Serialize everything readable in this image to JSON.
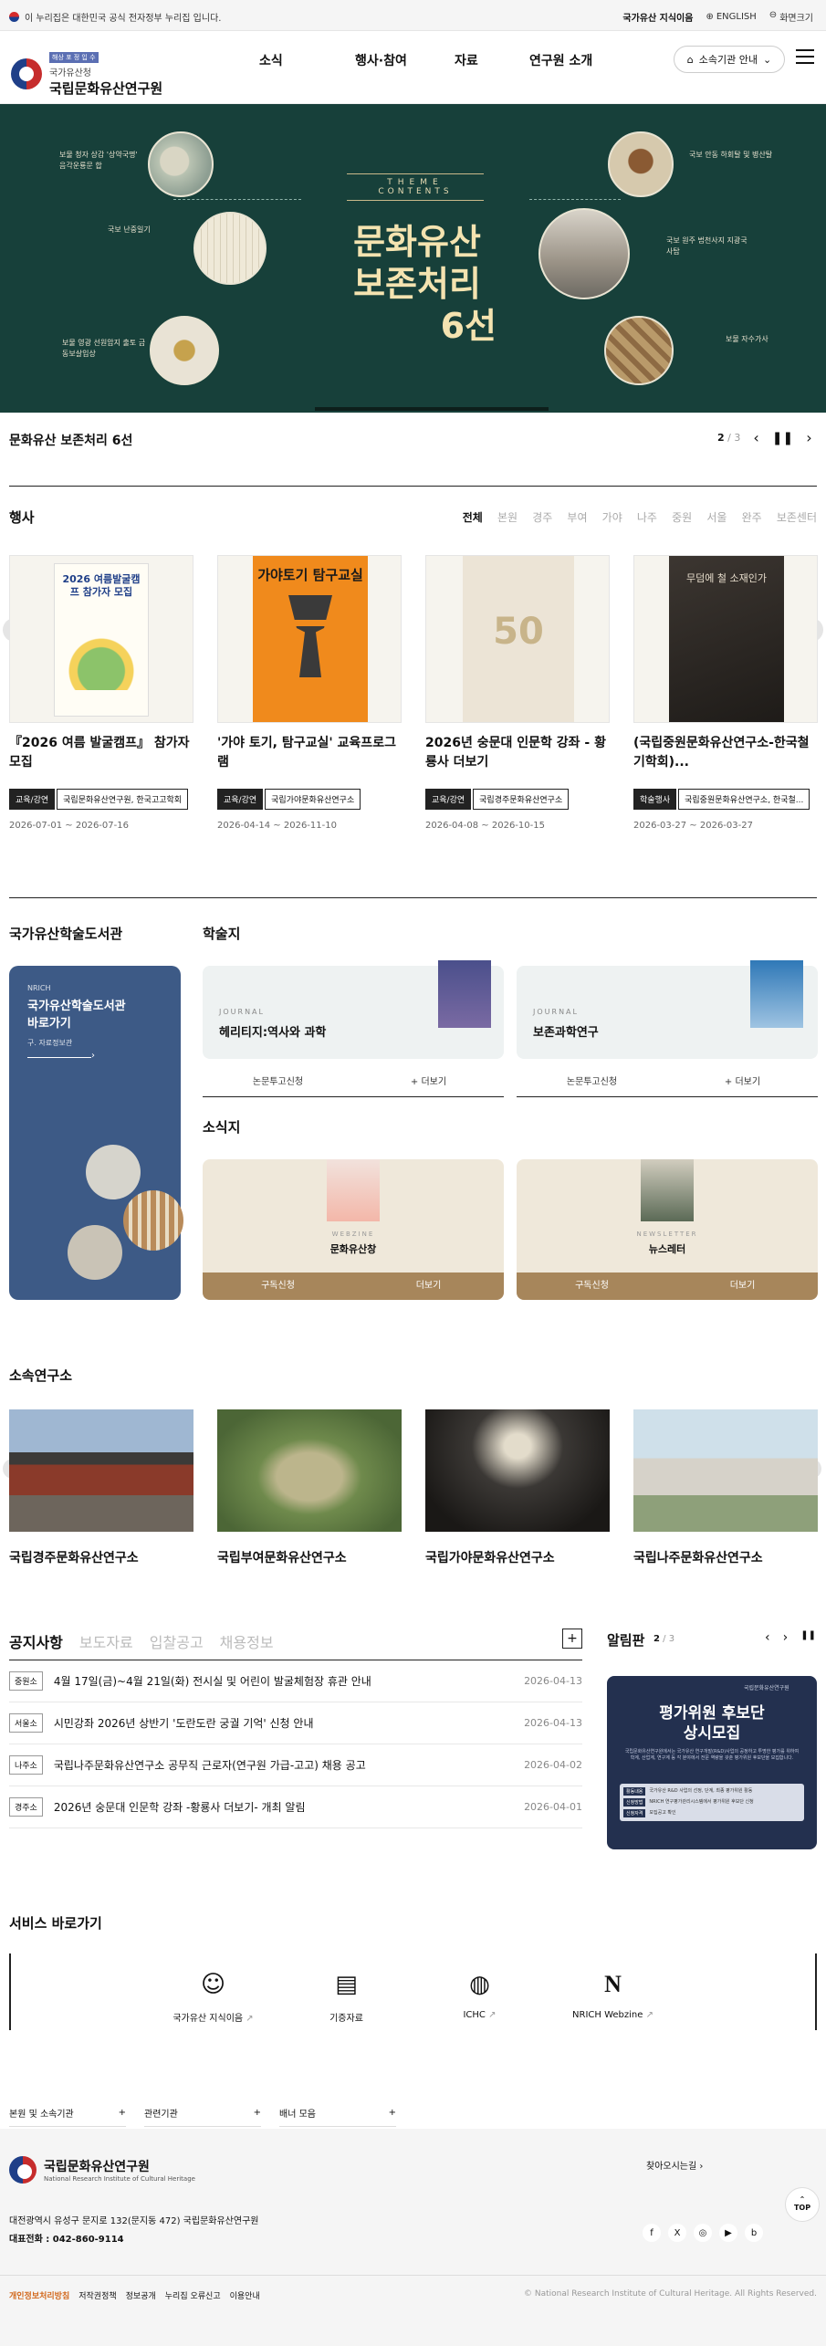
{
  "govbar": {
    "notice": "이 누리집은 대한민국 공식 전자정부 누리집 입니다.",
    "links": [
      "국가유산 지식이음",
      "ENGLISH",
      "화면크기"
    ]
  },
  "header": {
    "badge": "해상 포 정 입 수",
    "org_top": "국가유산청",
    "org_name": "국립문화유산연구원",
    "nav": [
      "소식",
      "행사·참여",
      "자료",
      "연구원 소개"
    ],
    "institute_btn": "소속기관 안내"
  },
  "hero": {
    "theme": "THEME",
    "contents": "CONTENTS",
    "title_line1": "문화유산",
    "title_line2": "보존처리",
    "title_num": "6선",
    "captions": [
      "보물 청자 상감 '상약국명' 음각운룡문 합",
      "국보 난중일기",
      "보물 영광 선원암지 출토 금동보살입상",
      "국보 안동 하회탈 및 병산탈",
      "국보 원주 법천사지 지광국사탑",
      "보물 자수가사"
    ]
  },
  "slide": {
    "caption": "문화유산 보존처리 6선",
    "current": "2",
    "total": "3"
  },
  "events": {
    "title": "행사",
    "tabs": [
      "전체",
      "본원",
      "경주",
      "부여",
      "가야",
      "나주",
      "중원",
      "서울",
      "완주",
      "보존센터"
    ],
    "items": [
      {
        "title": "『2026 여름 발굴캠프』 참가자 모집",
        "tags": [
          "교육/강연",
          "국립문화유산연구원, 한국고고학회"
        ],
        "date": "2026-07-01 ~ 2026-07-16",
        "poster_text": "2026 여름발굴캠프 참가자 모집"
      },
      {
        "title": "'가야 토기, 탐구교실' 교육프로그램",
        "tags": [
          "교육/강연",
          "국립가야문화유산연구소"
        ],
        "date": "2026-04-14 ~ 2026-11-10",
        "poster_text": "가야토기 탐구교실"
      },
      {
        "title": "2026년 숭문대 인문학 강좌 - 황룡사 더보기",
        "tags": [
          "교육/강연",
          "국립경주문화유산연구소"
        ],
        "date": "2026-04-08 ~ 2026-10-15",
        "poster_text": "50"
      },
      {
        "title": "(국립중원문화유산연구소-한국철기학회)...",
        "tags": [
          "학술행사",
          "국립중원문화유산연구소, 한국철..."
        ],
        "date": "2026-03-27 ~ 2026-03-27",
        "poster_text": "무덤에 철 소재인가"
      }
    ]
  },
  "library": {
    "title": "국가유산학술도서관",
    "card_small": "NRICH",
    "card_title1": "국가유산학술도서관",
    "card_title2": "바로가기",
    "card_sub": "구. 자료정보관",
    "journals_title": "학술지",
    "journals": [
      {
        "label": "JOURNAL",
        "name": "헤리티지:역사와 과학",
        "btn1": "논문투고신청",
        "btn2": "+ 더보기"
      },
      {
        "label": "JOURNAL",
        "name": "보존과학연구",
        "btn1": "논문투고신청",
        "btn2": "+ 더보기"
      }
    ],
    "news_title": "소식지",
    "mags": [
      {
        "label": "WEBZINE",
        "name": "문화유산창",
        "btn1": "구독신청",
        "btn2": "더보기"
      },
      {
        "label": "NEWSLETTER",
        "name": "뉴스레터",
        "btn1": "구독신청",
        "btn2": "더보기"
      }
    ]
  },
  "institutes": {
    "title": "소속연구소",
    "items": [
      "국립경주문화유산연구소",
      "국립부여문화유산연구소",
      "국립가야문화유산연구소",
      "국립나주문화유산연구소"
    ]
  },
  "notices": {
    "tabs": [
      "공지사항",
      "보도자료",
      "입찰공고",
      "채용정보"
    ],
    "rows": [
      {
        "badge": "중원소",
        "text": "4월 17일(금)~4월 21일(화) 전시실 및 어린이 발굴체험장 휴관 안내",
        "date": "2026-04-13"
      },
      {
        "badge": "서울소",
        "text": "시민강좌 2026년 상반기 '도란도란 궁궐 기억' 신청 안내",
        "date": "2026-04-13"
      },
      {
        "badge": "나주소",
        "text": "국립나주문화유산연구소 공무직 근로자(연구원 가급-고고) 채용 공고",
        "date": "2026-04-02"
      },
      {
        "badge": "경주소",
        "text": "2026년 숭문대 인문학 강좌 -황룡사 더보기- 개최 알림",
        "date": "2026-04-01"
      }
    ],
    "more": "+"
  },
  "alert": {
    "title": "알림판",
    "current": "2",
    "total": "3",
    "org": "국립문화유산연구원",
    "heading1": "평가위원 후보단",
    "heading2": "상시모집",
    "body": "국립문화유산연구원에서는 국가유산 연구개발(R&D)사업의 공정하고 투명한 평가를 위하여 학계, 산업계, 연구계 등 각 분야에서 전문 역량을 갖춘 평가위원 후보단을 모집합니다.",
    "rows": [
      {
        "k": "활동내용",
        "v": "국가유산 R&D 사업의 선정, 단계, 최종 평가위원 활동"
      },
      {
        "k": "신청방법",
        "v": "NRICH 연구평가관리시스템에서 평가위원 후보단 신청"
      },
      {
        "k": "신청자격",
        "v": "모집공고 확인"
      }
    ]
  },
  "services": {
    "title": "서비스 바로가기",
    "items": [
      {
        "label": "국가유산 지식이음",
        "icon": "robot-icon"
      },
      {
        "label": "기증자료",
        "icon": "document-icon"
      },
      {
        "label": "ICHC",
        "icon": "globe-icon"
      },
      {
        "label": "NRICH Webzine",
        "icon": "webzine-icon"
      }
    ]
  },
  "related": [
    "본원 및 소속기관",
    "관련기관",
    "배너 모음"
  ],
  "footer": {
    "org": "국립문화유산연구원",
    "org_en": "National Research Institute of Cultural Heritage",
    "map": "찾아오시는길",
    "address": "대전광역시 유성구 문지로 132(문지동 472) 국립문화유산연구원",
    "tel": "대표전화 : 042-860-9114",
    "links": [
      "개인정보처리방침",
      "저작권정책",
      "정보공개",
      "누리집 오류신고",
      "이용안내"
    ],
    "copyright": "© National Research Institute of Cultural Heritage. All Rights Reserved.",
    "top": "TOP"
  },
  "colors": {
    "hero_bg": "#17403a",
    "hero_title": "#f4e3b0",
    "library_card": "#3d5a86",
    "alert_bg": "#23304f",
    "privacy_link": "#d2691e"
  }
}
